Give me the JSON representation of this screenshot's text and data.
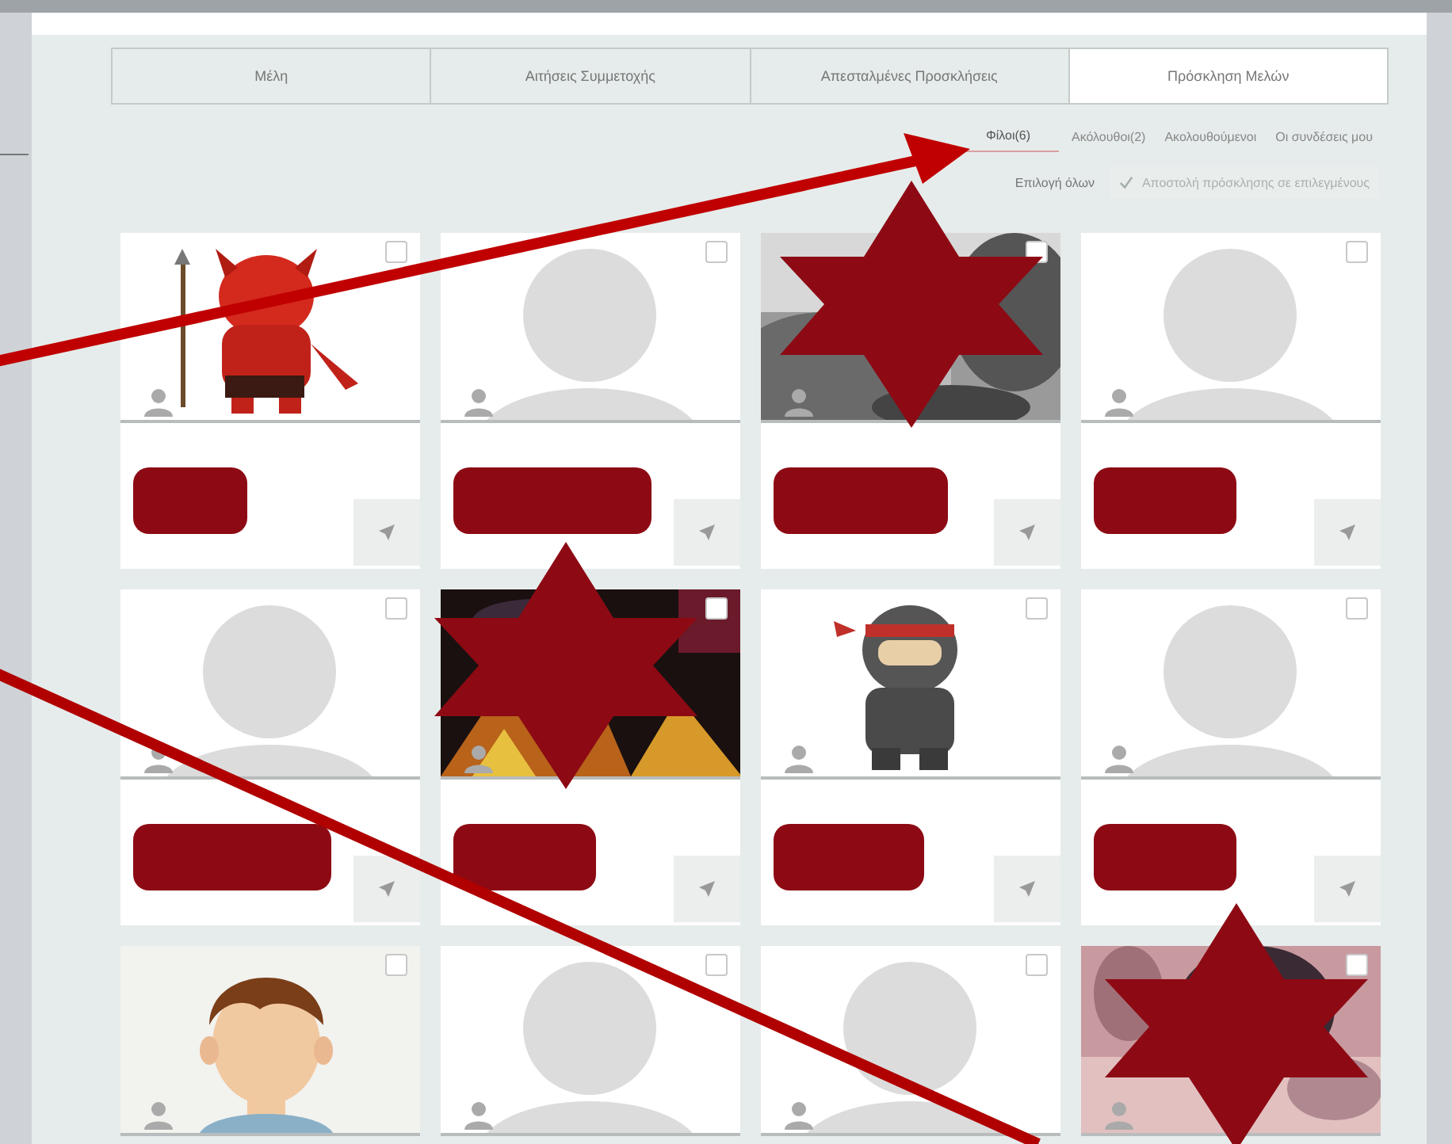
{
  "tabs": [
    {
      "label": "Μέλη",
      "selected": false
    },
    {
      "label": "Αιτήσεις Συμμετοχής",
      "selected": false
    },
    {
      "label": "Απεσταλμένες Προσκλήσεις",
      "selected": false
    },
    {
      "label": "Πρόσκληση Μελών",
      "selected": true
    }
  ],
  "filters": [
    {
      "label": "Φίλοι(6)",
      "selected": true
    },
    {
      "label": "Ακόλουθοι(2)",
      "selected": false
    },
    {
      "label": "Ακολουθούμενοι",
      "selected": false
    },
    {
      "label": "Οι συνδέσεις μου",
      "selected": false
    }
  ],
  "select_all": {
    "label": "Επιλογή όλων"
  },
  "invite_button": {
    "label": "Αποστολή πρόσκλησης σε επιλεγμένους",
    "disabled": true
  },
  "members": [
    {
      "kind": "picture",
      "checked": false
    },
    {
      "kind": "placeholder",
      "checked": false
    },
    {
      "kind": "picture",
      "checked": false
    },
    {
      "kind": "placeholder",
      "checked": false
    },
    {
      "kind": "placeholder",
      "checked": false
    },
    {
      "kind": "picture",
      "checked": false
    },
    {
      "kind": "picture",
      "checked": false
    },
    {
      "kind": "placeholder",
      "checked": false
    },
    {
      "kind": "picture",
      "checked": false
    },
    {
      "kind": "placeholder",
      "checked": false
    },
    {
      "kind": "placeholder",
      "checked": false
    },
    {
      "kind": "picture",
      "checked": false
    }
  ],
  "annotations": [
    {
      "kind": "arrow"
    },
    {
      "kind": "arrow"
    },
    {
      "kind": "star"
    },
    {
      "kind": "star"
    },
    {
      "kind": "star"
    }
  ]
}
